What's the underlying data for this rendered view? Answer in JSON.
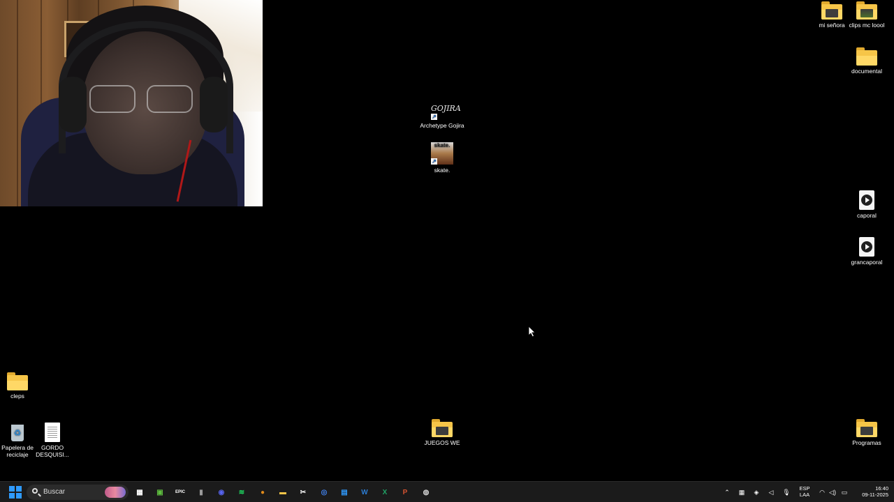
{
  "desktop": {
    "icons": [
      {
        "id": "mi-senora",
        "label": "mi señora"
      },
      {
        "id": "clips-mc",
        "label": "clips mc loool"
      },
      {
        "id": "documental",
        "label": "documental"
      },
      {
        "id": "archetype",
        "label": "Archetype Gojira"
      },
      {
        "id": "skate",
        "label": "skate."
      },
      {
        "id": "caporal",
        "label": "caporal"
      },
      {
        "id": "grancaporal",
        "label": "grancaporal"
      },
      {
        "id": "cleps",
        "label": "cleps"
      },
      {
        "id": "papelera",
        "label": "Papelera de reciclaje"
      },
      {
        "id": "gordo",
        "label": "GORDO DESQUISI..."
      },
      {
        "id": "juegos",
        "label": "JUEGOS WE"
      },
      {
        "id": "programas",
        "label": "Programas"
      }
    ],
    "shortcut_art": {
      "gojira": "GOJIRA",
      "skate": "skate."
    }
  },
  "taskbar": {
    "search_placeholder": "Buscar",
    "apps": [
      {
        "name": "microsoft-store-icon",
        "glyph": "▦",
        "color": "#ffffff"
      },
      {
        "name": "minecraft-icon",
        "glyph": "▣",
        "color": "#5fbf3f"
      },
      {
        "name": "epic-games-icon",
        "glyph": "EPIC",
        "color": "#ffffff"
      },
      {
        "name": "usb-device-icon",
        "glyph": "▮",
        "color": "#9a9a9a"
      },
      {
        "name": "discord-icon",
        "glyph": "◉",
        "color": "#5865f2"
      },
      {
        "name": "spotify-icon",
        "glyph": "≋",
        "color": "#1ed760"
      },
      {
        "name": "game-launcher-icon",
        "glyph": "●",
        "color": "#e08a1a"
      },
      {
        "name": "file-explorer-icon",
        "glyph": "▬",
        "color": "#f6c548"
      },
      {
        "name": "snipping-tool-icon",
        "glyph": "✂",
        "color": "#ffffff"
      },
      {
        "name": "chrome-icon",
        "glyph": "◎",
        "color": "#4285f4"
      },
      {
        "name": "terminal-icon",
        "glyph": "▤",
        "color": "#2f9bff"
      },
      {
        "name": "word-icon",
        "glyph": "W",
        "color": "#2b7cd3"
      },
      {
        "name": "excel-icon",
        "glyph": "X",
        "color": "#21a366"
      },
      {
        "name": "powerpoint-icon",
        "glyph": "P",
        "color": "#d35230"
      },
      {
        "name": "obs-icon",
        "glyph": "◍",
        "color": "#d0d0d0"
      }
    ],
    "tray": {
      "language_line1": "ESP",
      "language_line2": "LAA",
      "time": "16:40",
      "date": "09-11-2025"
    }
  }
}
